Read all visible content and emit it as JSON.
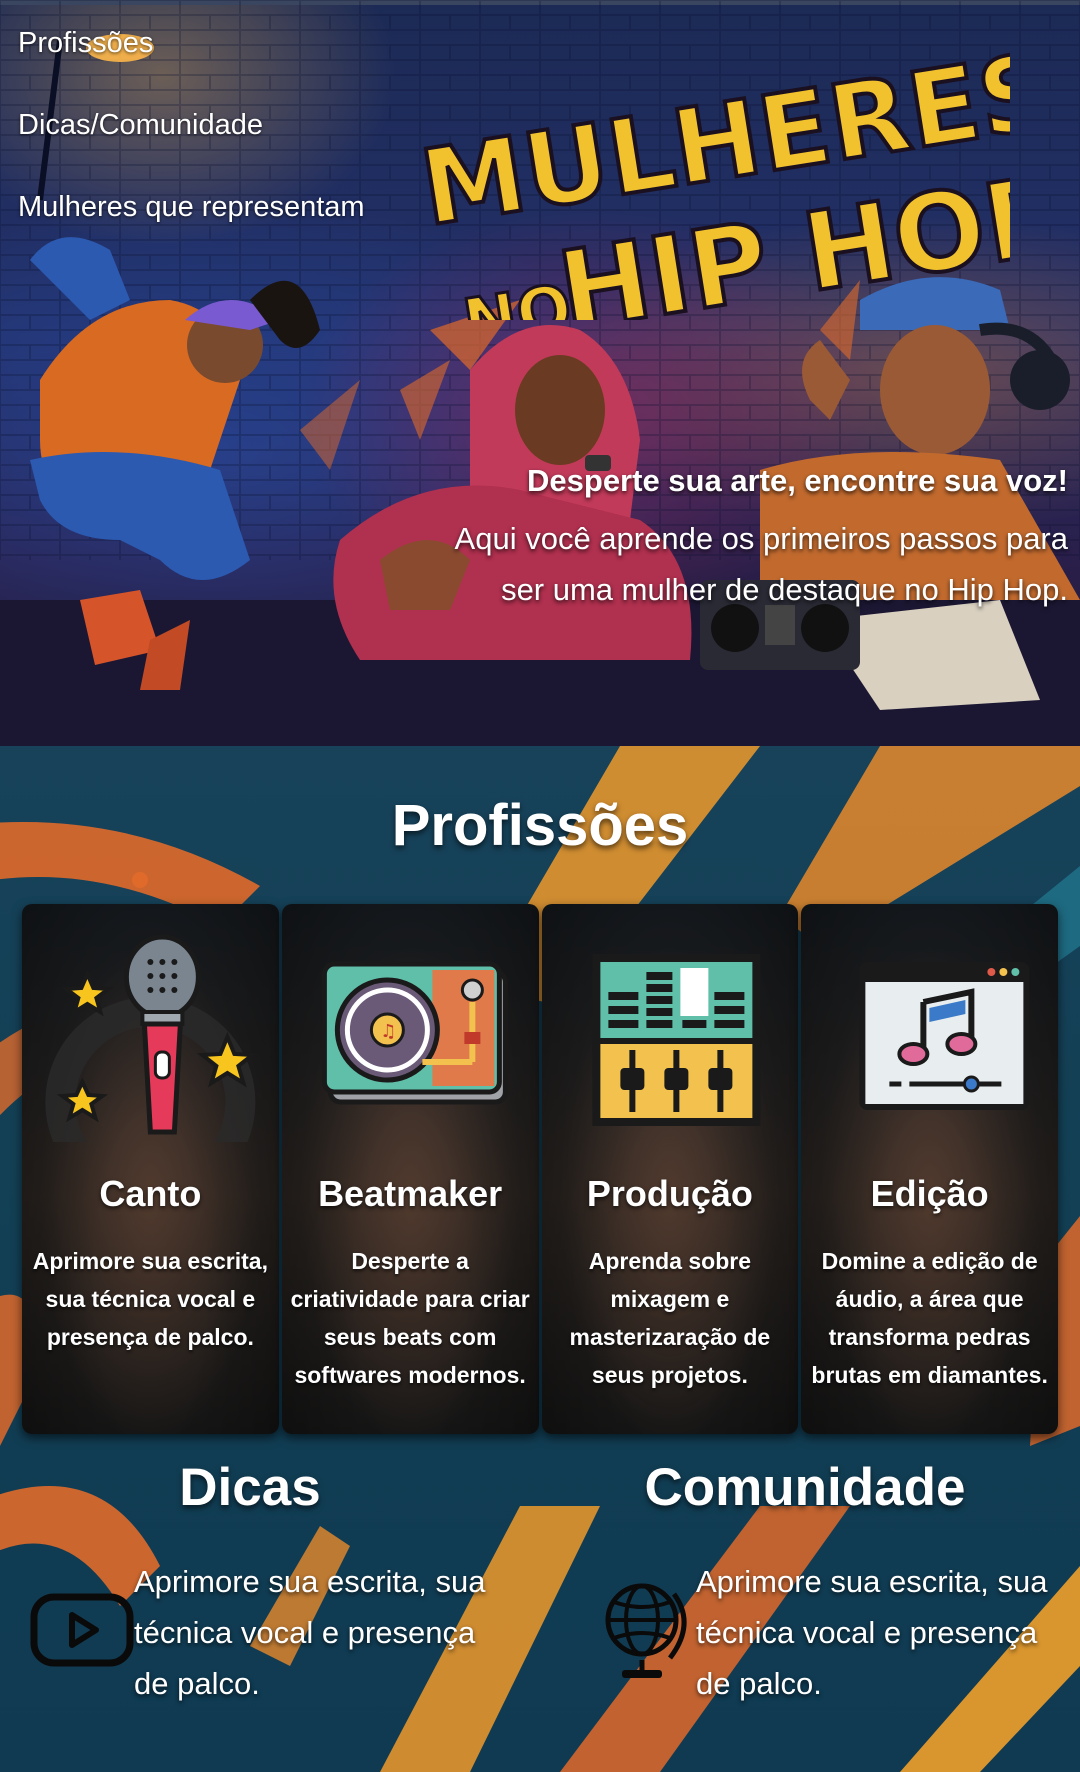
{
  "nav": {
    "items": [
      {
        "label": "Profissões"
      },
      {
        "label": "Dicas/Comunidade"
      },
      {
        "label": "Mulheres que representam"
      }
    ]
  },
  "hero": {
    "logo_line1": "MULHERES",
    "logo_line2_small": "NO",
    "logo_line2_big": "HIP HOP",
    "tagline_lead": "Desperte sua arte, encontre sua voz!",
    "tagline_sub": "Aqui você aprende os primeiros passos para ser uma mulher de destaque no Hip Hop."
  },
  "profissoes": {
    "title": "Profissões",
    "cards": [
      {
        "title": "Canto",
        "description": "Aprimore sua escrita, sua técnica vocal e presença de palco.",
        "icon": "microphone-icon"
      },
      {
        "title": "Beatmaker",
        "description": "Desperte a criatividade para criar seus beats com softwares modernos.",
        "icon": "turntable-icon"
      },
      {
        "title": "Produção",
        "description": "Aprenda sobre mixagem e masterizaração de seus projetos.",
        "icon": "mixer-icon"
      },
      {
        "title": "Edição",
        "description": "Domine a edição de áudio, a área que transforma pedras brutas em diamantes.",
        "icon": "music-editor-icon"
      }
    ]
  },
  "dicas": {
    "title": "Dicas",
    "text": "Aprimore sua escrita, sua técnica vocal e presença de palco.",
    "icon": "youtube-play-icon"
  },
  "comunidade": {
    "title": "Comunidade",
    "text": "Aprimore sua escrita, sua técnica vocal e presença de palco.",
    "icon": "globe-icon"
  },
  "colors": {
    "logo_yellow": "#f2c12e",
    "paint_orange": "#e06a2a",
    "paint_teal": "#17425a"
  }
}
